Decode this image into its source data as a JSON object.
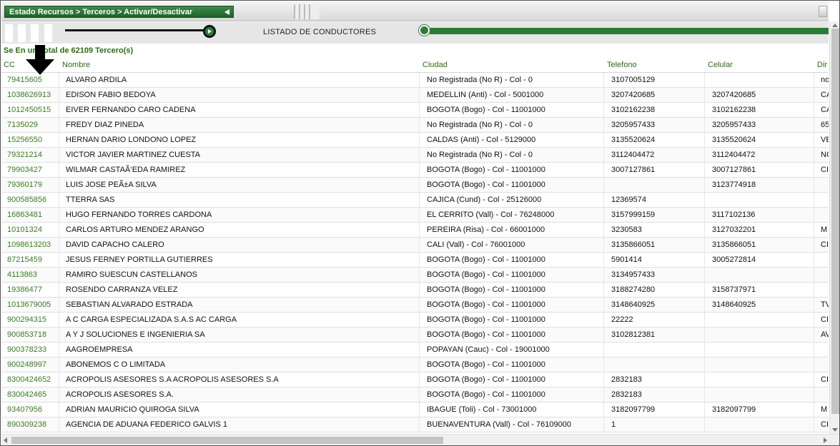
{
  "breadcrumb": "Estado Recursos > Terceros > Activar/Desactivar",
  "listado_title": "LISTADO DE CONDUCTORES",
  "summary": "Se Encontró un Total de 62109 Tercero(s)",
  "summary_visible": "Se En        un Total de 62109 Tercero(s)",
  "progress_fraction": 1.0,
  "colors": {
    "brand_green": "#2c7a37",
    "header_text": "#2e6b14"
  },
  "icons": [
    "back-arrow-icon",
    "play-icon",
    "progress-dot-icon",
    "down-arrow-annotation-icon"
  ],
  "table": {
    "headers": {
      "cc": "CC",
      "nombre": "Nombre",
      "ciudad": "Ciudad",
      "telefono": "Telefono",
      "celular": "Celular",
      "dir": "Dir"
    },
    "rows": [
      {
        "cc": "79415605",
        "nombre": "ALVARO ARDILA",
        "ciudad": "No Registrada (No R) - Col - 0",
        "telefono": "3107005129",
        "celular": "",
        "dir": "no"
      },
      {
        "cc": "1038626913",
        "nombre": "EDISON FABIO BEDOYA",
        "ciudad": "MEDELLIN (Anti) - Col - 5001000",
        "telefono": "3207420685",
        "celular": "3207420685",
        "dir": "CA"
      },
      {
        "cc": "1012450515",
        "nombre": "EIVER FERNANDO CARO CADENA",
        "ciudad": "BOGOTA (Bogo) - Col - 11001000",
        "telefono": "3102162238",
        "celular": "3102162238",
        "dir": "CA"
      },
      {
        "cc": "7135029",
        "nombre": "FREDY DIAZ PINEDA",
        "ciudad": "No Registrada (No R) - Col - 0",
        "telefono": "3205957433",
        "celular": "3205957433",
        "dir": "65"
      },
      {
        "cc": "15256550",
        "nombre": "HERNAN DARIO LONDONO LOPEZ",
        "ciudad": "CALDAS (Anti) - Col - 5129000",
        "telefono": "3135520624",
        "celular": "3135520624",
        "dir": "VE"
      },
      {
        "cc": "79321214",
        "nombre": "VICTOR JAVIER MARTINEZ CUESTA",
        "ciudad": "No Registrada (No R) - Col - 0",
        "telefono": "3112404472",
        "celular": "3112404472",
        "dir": "NC"
      },
      {
        "cc": "79903427",
        "nombre": "WILMAR CASTAÃ‘EDA RAMIREZ",
        "ciudad": "BOGOTA (Bogo) - Col - 11001000",
        "telefono": "3007127861",
        "celular": "3007127861",
        "dir": "CI"
      },
      {
        "cc": "79360179",
        "nombre": "LUIS JOSE PEÃ±A SILVA",
        "ciudad": "BOGOTA (Bogo) - Col - 11001000",
        "telefono": "",
        "celular": "3123774918",
        "dir": ""
      },
      {
        "cc": "900585856",
        "nombre": "TTERRA SAS",
        "ciudad": "CAJICA (Cund) - Col - 25126000",
        "telefono": "12369574",
        "celular": "",
        "dir": ""
      },
      {
        "cc": "16863481",
        "nombre": "HUGO FERNANDO TORRES CARDONA",
        "ciudad": "EL CERRITO (Vall) - Col - 76248000",
        "telefono": "3157999159",
        "celular": "3117102136",
        "dir": ""
      },
      {
        "cc": "10101324",
        "nombre": "CARLOS ARTURO MENDEZ ARANGO",
        "ciudad": "PEREIRA (Risa) - Col - 66001000",
        "telefono": "3230583",
        "celular": "3127032201",
        "dir": "M"
      },
      {
        "cc": "1098613203",
        "nombre": "DAVID CAPACHO CALERO",
        "ciudad": "CALI (Vall) - Col - 76001000",
        "telefono": "3135866051",
        "celular": "3135866051",
        "dir": "CI"
      },
      {
        "cc": "87215459",
        "nombre": "JESUS FERNEY PORTILLA GUTIERRES",
        "ciudad": "BOGOTA (Bogo) - Col - 11001000",
        "telefono": "5901414",
        "celular": "3005272814",
        "dir": ""
      },
      {
        "cc": "4113863",
        "nombre": "RAMIRO SUESCUN CASTELLANOS",
        "ciudad": "BOGOTA (Bogo) - Col - 11001000",
        "telefono": "3134957433",
        "celular": "",
        "dir": ""
      },
      {
        "cc": "19386477",
        "nombre": "ROSENDO CARRANZA VELEZ",
        "ciudad": "BOGOTA (Bogo) - Col - 11001000",
        "telefono": "3188274280",
        "celular": "3158737971",
        "dir": ""
      },
      {
        "cc": "1013679005",
        "nombre": "SEBASTIAN ALVARADO ESTRADA",
        "ciudad": "BOGOTA (Bogo) - Col - 11001000",
        "telefono": "3148640925",
        "celular": "3148640925",
        "dir": "TV"
      },
      {
        "cc": "900294315",
        "nombre": "A C CARGA ESPECIALIZADA S.A.S AC CARGA",
        "ciudad": "BOGOTA (Bogo) - Col - 11001000",
        "telefono": "22222",
        "celular": "",
        "dir": "CI"
      },
      {
        "cc": "900853718",
        "nombre": "A Y J SOLUCIONES E INGENIERIA SA",
        "ciudad": "BOGOTA (Bogo) - Col - 11001000",
        "telefono": "3102812381",
        "celular": "",
        "dir": "AV"
      },
      {
        "cc": "900378233",
        "nombre": "AAGROEMPRESA",
        "ciudad": "POPAYAN (Cauc) - Col - 19001000",
        "telefono": "",
        "celular": "",
        "dir": ""
      },
      {
        "cc": "900248997",
        "nombre": "ABONEMOS C O LIMITADA",
        "ciudad": "BOGOTA (Bogo) - Col - 11001000",
        "telefono": "",
        "celular": "",
        "dir": ""
      },
      {
        "cc": "8300424652",
        "nombre": "ACROPOLIS ASESORES S.A ACROPOLIS ASESORES S.A",
        "ciudad": "BOGOTA (Bogo) - Col - 11001000",
        "telefono": "2832183",
        "celular": "",
        "dir": "CI"
      },
      {
        "cc": "830042465",
        "nombre": "ACROPOLIS ASESORES S.A.",
        "ciudad": "BOGOTA (Bogo) - Col - 11001000",
        "telefono": "2832183",
        "celular": "",
        "dir": ""
      },
      {
        "cc": "93407956",
        "nombre": "ADRIAN MAURICIO QUIROGA SILVA",
        "ciudad": "IBAGUE (Toli) - Col - 73001000",
        "telefono": "3182097799",
        "celular": "3182097799",
        "dir": "M"
      },
      {
        "cc": "890309238",
        "nombre": "AGENCIA DE ADUANA FEDERICO GALVIS 1",
        "ciudad": "BUENAVENTURA (Vall) - Col - 76109000",
        "telefono": "1",
        "celular": "",
        "dir": "CI"
      }
    ]
  }
}
